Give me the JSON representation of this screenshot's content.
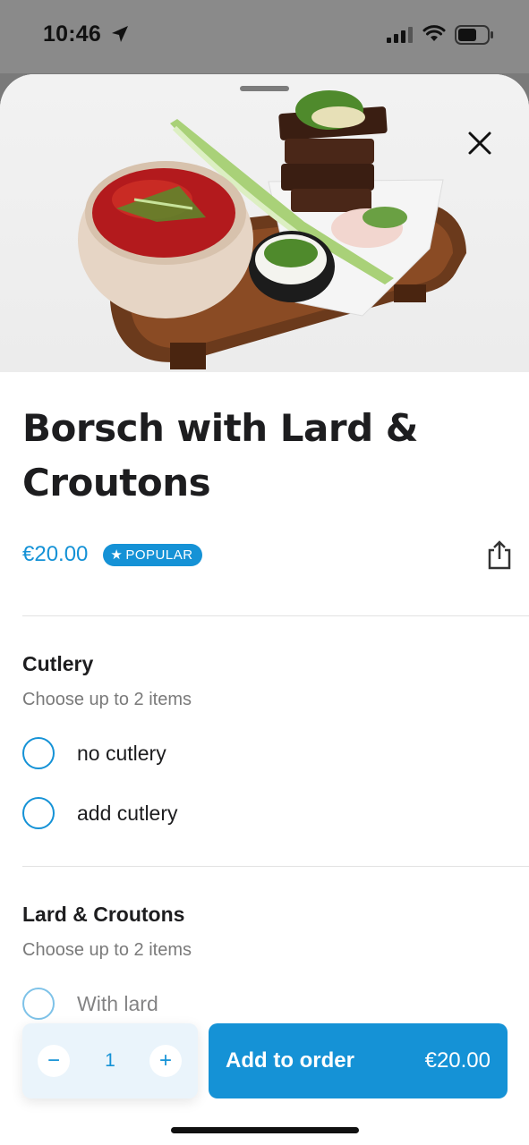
{
  "status_bar": {
    "time": "10:46",
    "icons": [
      "location-arrow-icon",
      "signal-icon",
      "wifi-icon",
      "battery-icon"
    ]
  },
  "product": {
    "image": "borsch-with-lard-croutons-photo",
    "title": "Borsch with Lard & Croutons",
    "price": "€20.00",
    "badge": "POPULAR",
    "badge_icon": "star-icon"
  },
  "sections": [
    {
      "title": "Cutlery",
      "subtitle": "Choose up to 2 items",
      "options": [
        {
          "label": "no cutlery",
          "selected": false
        },
        {
          "label": "add cutlery",
          "selected": false
        }
      ]
    },
    {
      "title": "Lard & Croutons",
      "subtitle": "Choose up to 2 items",
      "options": [
        {
          "label": "With lard",
          "selected": false
        }
      ]
    }
  ],
  "order_bar": {
    "quantity": "1",
    "minus_label": "−",
    "plus_label": "+",
    "add_label": "Add to order",
    "add_price": "€20.00"
  },
  "colors": {
    "accent": "#1592d6",
    "text": "#1d1d1f",
    "muted": "#7a7a7a",
    "qty_bg": "#eaf4fb"
  }
}
